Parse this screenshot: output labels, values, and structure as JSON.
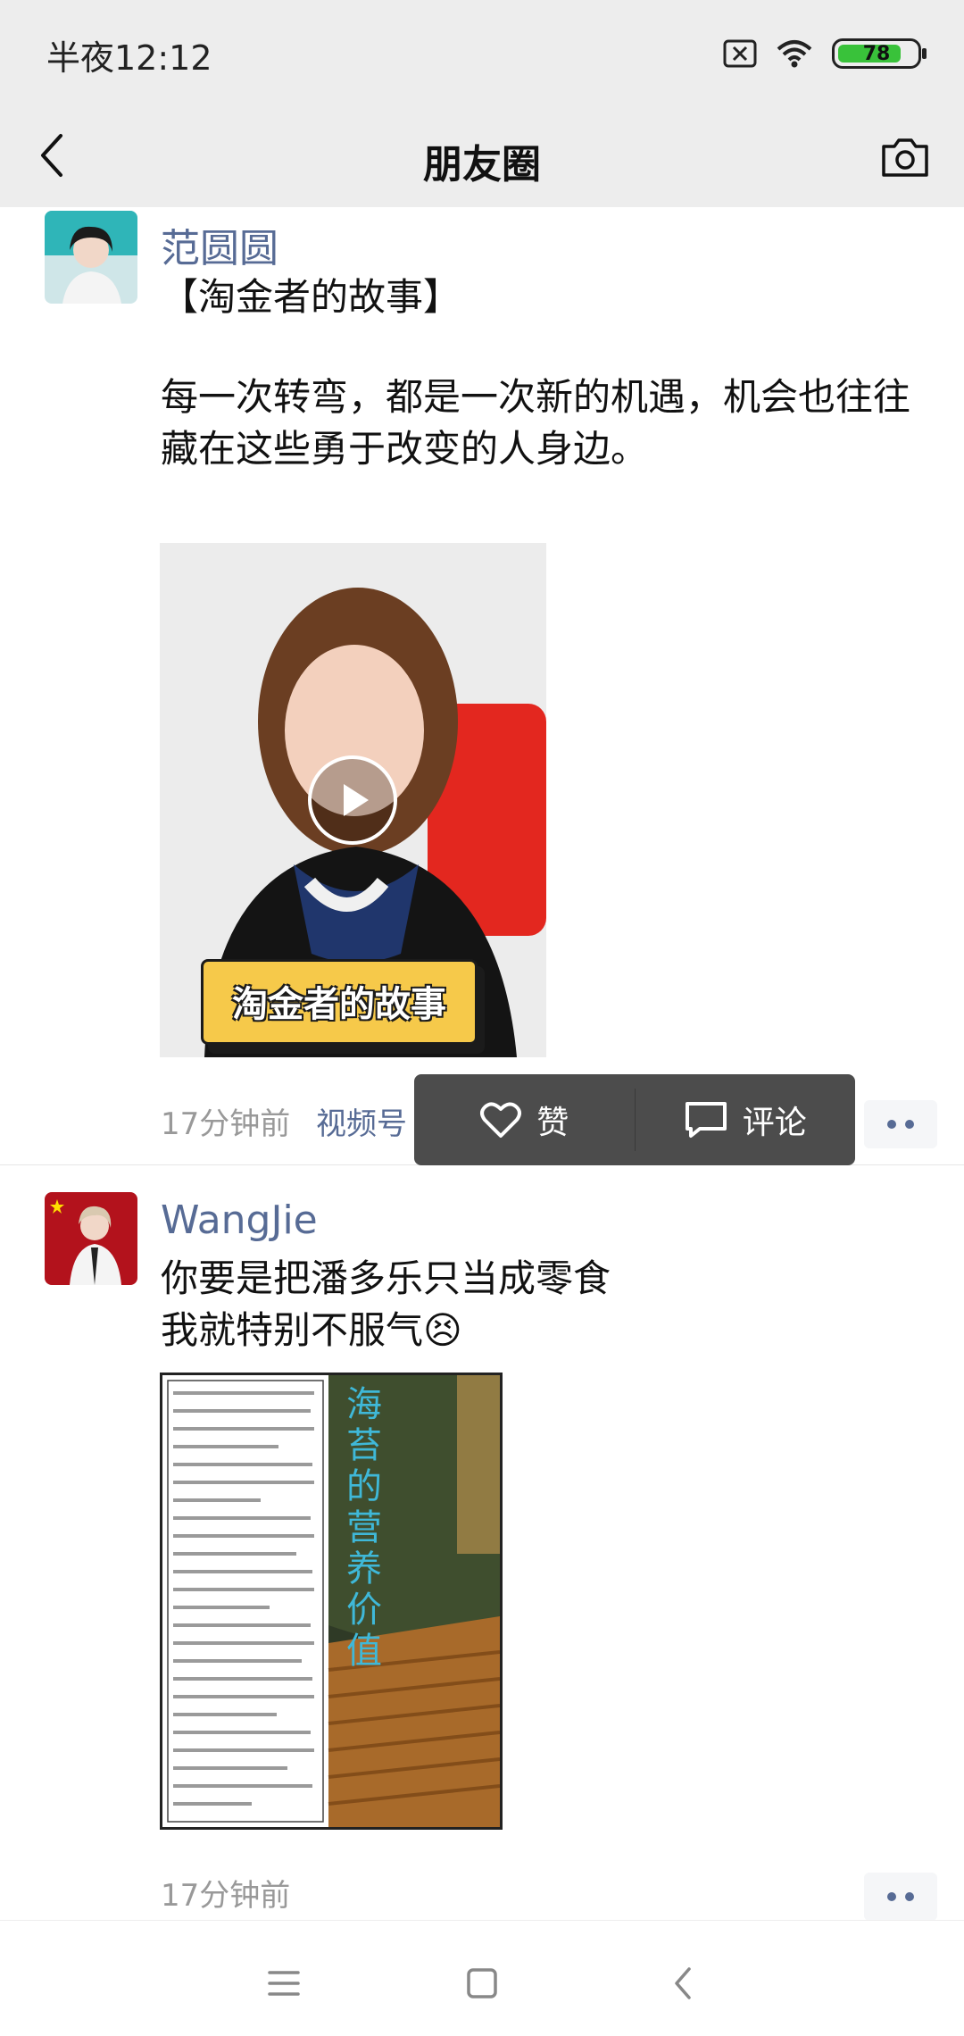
{
  "status_bar": {
    "time": "半夜12:12",
    "battery_level": "78",
    "icons": [
      "sim-disabled-icon",
      "wifi-icon",
      "battery-icon"
    ]
  },
  "navbar": {
    "title": "朋友圈",
    "back_icon": "chevron-left-icon",
    "camera_icon": "camera-icon"
  },
  "posts": [
    {
      "author": "范圆圆",
      "text_title": "【淘金者的故事】",
      "text_body": "每一次转弯，都是一次新的机遇，机会也往往藏在这些勇于改变的人身边。",
      "media": {
        "type": "video",
        "caption_overlay": "淘金者的故事",
        "play_icon": "play-icon"
      },
      "time": "17分钟前",
      "source_link": "视频号"
    },
    {
      "author": "WangJie",
      "text_line1": "你要是把潘多乐只当成零食",
      "text_line2": "我就特别不服气",
      "emoji": "😣",
      "media": {
        "type": "image",
        "image_title": "海苔的营养价值"
      },
      "time": "17分钟前"
    }
  ],
  "action_popup": {
    "like_label": "赞",
    "comment_label": "评论"
  },
  "colors": {
    "link_blue": "#576b95",
    "header_bg": "#ededed",
    "popup_bg": "#4c4c4c"
  }
}
